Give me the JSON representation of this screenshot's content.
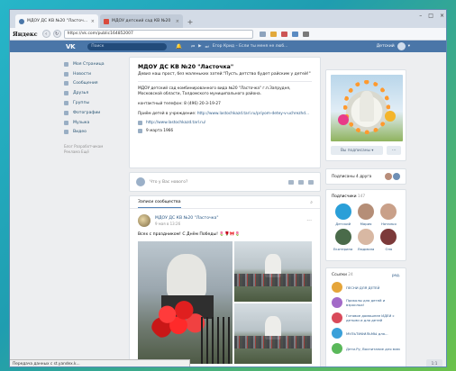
{
  "browser": {
    "tabs": [
      {
        "label": "МДОУ ДС КВ №20 \"Ласточ...",
        "active": true
      },
      {
        "label": "МДОУ детский сад КВ №20",
        "active": false
      }
    ],
    "brand": "Яндекс",
    "url": "https://vk.com/public164852007"
  },
  "vk": {
    "logo": "VK",
    "search_placeholder": "Поиск",
    "player_track": "Егор Крид – Если ты меня не люб...",
    "user_name": "Детский"
  },
  "left_menu": [
    "Моя Страница",
    "Новости",
    "Сообщения",
    "Друзья",
    "Группы",
    "Фотографии",
    "Музыка",
    "Видео"
  ],
  "footer_links": [
    "Блог",
    "Разработчикам",
    "Реклама",
    "Ещё"
  ],
  "group": {
    "title": "МДОУ ДС КВ №20 \"Ласточка\"",
    "status": "Девиз наш прост, без маленьких затей:\"Пусть детство будет райским у детей!\"",
    "description": "МДОУ детский сад комбинированного вида №20 \"Ласточка\" г.п.Запрудня, Московской области, Талдомского муниципального района.",
    "phone_line": "контактный телефон: 8 (496) 20-3-19-27",
    "admission_label": "Приём детей в учреждение:",
    "admission_link": "http://www.lastochkazd.tarl.ru/priyom-detey-v-uchrezhd...",
    "website": "http://www.lastochkazd.tarl.ru/",
    "founded": "9 марта 1966"
  },
  "new_post_placeholder": "Что у Вас нового?",
  "wall": {
    "tab": "Записи сообщества",
    "post": {
      "author": "МДОУ ДС КВ №20 \"Ласточка\"",
      "date": "9 мая в 13:26",
      "text": "Всех с праздником! С Днём Победы!"
    }
  },
  "sidebar": {
    "subscribe_button": "Вы подписаны",
    "more_button": "···",
    "friends_label": "Подписаны 4 друга",
    "followers_label": "Подписчики",
    "followers_count": "147",
    "followers": [
      {
        "name": "Детский",
        "color": "#2a9fd8"
      },
      {
        "name": "Мария",
        "color": "#b58e77"
      },
      {
        "name": "Наталья",
        "color": "#c9a089"
      },
      {
        "name": "Екатерина",
        "color": "#4a6b4a"
      },
      {
        "name": "Людмила",
        "color": "#d8b8a3"
      },
      {
        "name": "Оля",
        "color": "#7c3a3a"
      }
    ],
    "links_label": "Ссылки",
    "links_count": "24",
    "links_edit": "ред.",
    "links": [
      {
        "text": "ПЕСНИ ДЛЯ ДЕТЕЙ",
        "color": "#e5a53a"
      },
      {
        "text": "Приколы для детей и взрослых!",
        "color": "#a36ac8"
      },
      {
        "text": "Готовое домашнее ИДЕИ с детьми и для детей",
        "color": "#d94a5a"
      },
      {
        "text": "МУЛЬТИФИЛЬМЫ для...",
        "color": "#3aa0d9"
      },
      {
        "text": "Дети.Ру, Воспитание для мам",
        "color": "#5ab85a"
      }
    ]
  },
  "statusbar_text": "Передача данных с st.yandex.k...",
  "page_badge": "1:1"
}
